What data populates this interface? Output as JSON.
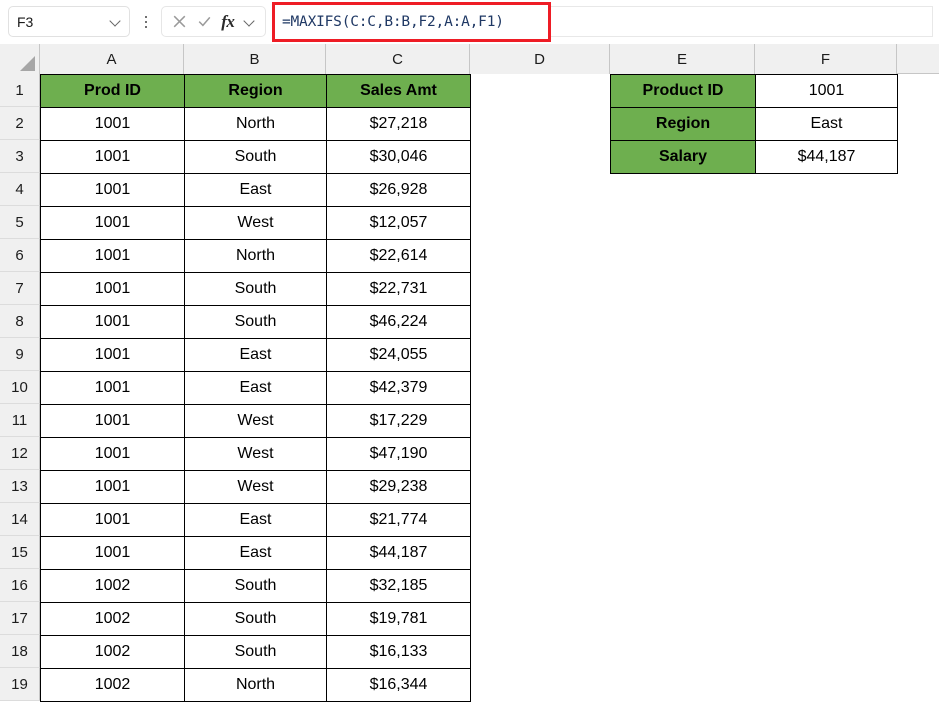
{
  "app": "excel-spreadsheet",
  "formula_bar": {
    "name_box_value": "F3",
    "name_box_icon": "chevron-down-icon",
    "kebab_icon": "vertical-ellipsis-icon",
    "cancel_icon": "x-cancel-icon",
    "confirm_icon": "check-enter-icon",
    "function_icon": "fx-insert-function-icon",
    "function_label": "fx",
    "dropdown_icon": "chevron-down-icon",
    "formula": "=MAXIFS(C:C,B:B,F2,A:A,F1)",
    "highlight_color": "#EE1C25",
    "formula_text_color": "#1F3864"
  },
  "grid": {
    "column_headers": [
      "A",
      "B",
      "C",
      "D",
      "E",
      "F"
    ],
    "row_headers": [
      "1",
      "2",
      "3",
      "4",
      "5",
      "6",
      "7",
      "8",
      "9",
      "10",
      "11",
      "12",
      "13",
      "14",
      "15",
      "16",
      "17",
      "18",
      "19"
    ],
    "header_fill": "#6EAF4F",
    "gutter_fill": "#F0F0F0"
  },
  "sales_table": {
    "headers": [
      "Prod ID",
      "Region",
      "Sales Amt"
    ],
    "rows": [
      [
        "1001",
        "North",
        "$27,218"
      ],
      [
        "1001",
        "South",
        "$30,046"
      ],
      [
        "1001",
        "East",
        "$26,928"
      ],
      [
        "1001",
        "West",
        "$12,057"
      ],
      [
        "1001",
        "North",
        "$22,614"
      ],
      [
        "1001",
        "South",
        "$22,731"
      ],
      [
        "1001",
        "South",
        "$46,224"
      ],
      [
        "1001",
        "East",
        "$24,055"
      ],
      [
        "1001",
        "East",
        "$42,379"
      ],
      [
        "1001",
        "West",
        "$17,229"
      ],
      [
        "1001",
        "West",
        "$47,190"
      ],
      [
        "1001",
        "West",
        "$29,238"
      ],
      [
        "1001",
        "East",
        "$21,774"
      ],
      [
        "1001",
        "East",
        "$44,187"
      ],
      [
        "1002",
        "South",
        "$32,185"
      ],
      [
        "1002",
        "South",
        "$19,781"
      ],
      [
        "1002",
        "South",
        "$16,133"
      ],
      [
        "1002",
        "North",
        "$16,344"
      ]
    ]
  },
  "lookup_table": {
    "rows": [
      {
        "label": "Product ID",
        "value": "1001"
      },
      {
        "label": "Region",
        "value": "East"
      },
      {
        "label": "Salary",
        "value": "$44,187"
      }
    ]
  }
}
